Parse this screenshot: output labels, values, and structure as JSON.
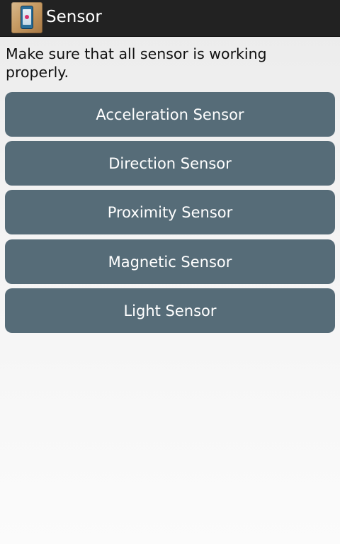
{
  "app": {
    "title": "Sensor",
    "icon": "phone-sensor-icon"
  },
  "intro_text": "Make sure that all sensor is working properly.",
  "buttons": [
    {
      "label": "Acceleration Sensor"
    },
    {
      "label": "Direction Sensor"
    },
    {
      "label": "Proximity Sensor"
    },
    {
      "label": "Magnetic Sensor"
    },
    {
      "label": "Light Sensor"
    }
  ],
  "colors": {
    "action_bar": "#222222",
    "button": "#566c78",
    "button_text": "#ffffff"
  }
}
